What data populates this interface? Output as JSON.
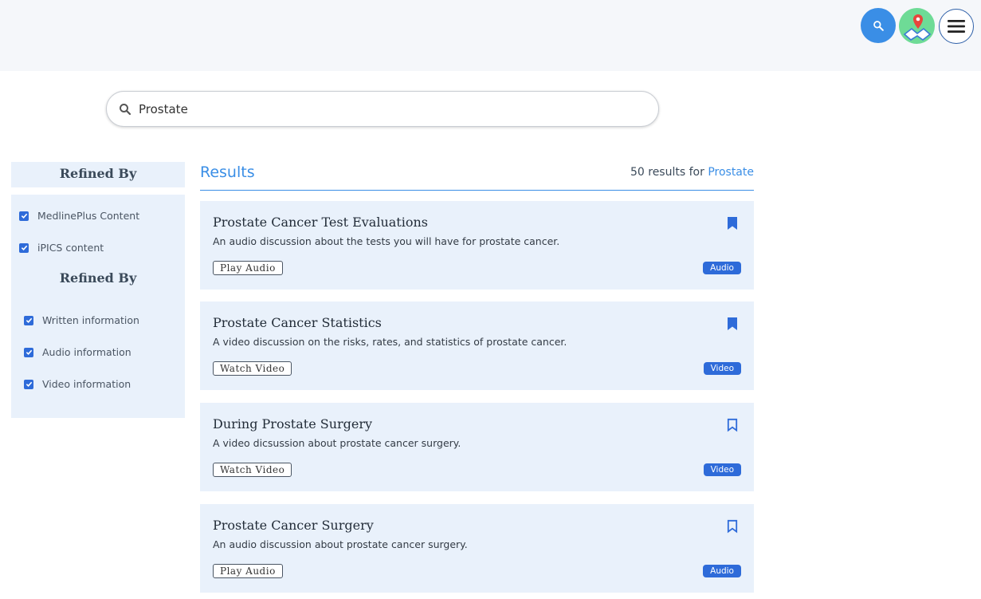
{
  "header": {
    "icons": {
      "search": "search-icon",
      "map": "map-icon",
      "menu": "menu-icon"
    }
  },
  "search": {
    "value": "Prostate",
    "placeholder": ""
  },
  "sidebar": {
    "section1_title": "Refined By",
    "section1_filters": [
      {
        "label": "MedlinePlus Content",
        "checked": true
      },
      {
        "label": "iPICS content",
        "checked": true
      }
    ],
    "section2_title": "Refined By",
    "section2_filters": [
      {
        "label": "Written information",
        "checked": true
      },
      {
        "label": "Audio information",
        "checked": true
      },
      {
        "label": "Video information",
        "checked": true
      }
    ]
  },
  "results": {
    "title": "Results",
    "count_text": "50 results for",
    "query": "Prostate",
    "items": [
      {
        "title": "Prostate Cancer Test Evaluations",
        "description": "An audio discussion about the tests you will have for prostate cancer.",
        "action": "Play Audio",
        "badge": "Audio",
        "bookmarked": true
      },
      {
        "title": "Prostate Cancer Statistics",
        "description": "A video discussion on the risks, rates, and statistics of prostate cancer.",
        "action": "Watch Video",
        "badge": "Video",
        "bookmarked": true
      },
      {
        "title": "During Prostate Surgery",
        "description": "A video dicsussion about prostate cancer surgery.",
        "action": "Watch Video",
        "badge": "Video",
        "bookmarked": false
      },
      {
        "title": "Prostate Cancer Surgery",
        "description": "An audio discussion about prostate cancer surgery.",
        "action": "Play Audio",
        "badge": "Audio",
        "bookmarked": false
      }
    ]
  },
  "colors": {
    "accent": "#3a8ee6",
    "badge": "#2e6bd9",
    "panel_bg": "#e9f1fb",
    "map_button": "#6edb96"
  }
}
